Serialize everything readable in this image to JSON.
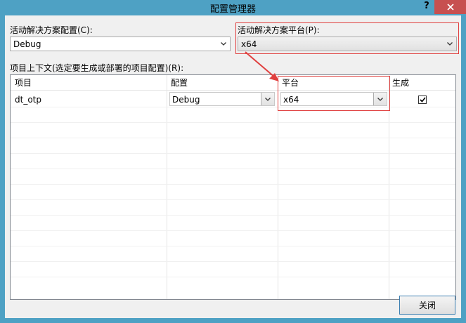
{
  "window": {
    "title": "配置管理器",
    "help_label": "?"
  },
  "active_config": {
    "label": "活动解决方案配置(C):",
    "value": "Debug"
  },
  "active_platform": {
    "label": "活动解决方案平台(P):",
    "value": "x64"
  },
  "project_context": {
    "label": "项目上下文(选定要生成或部署的项目配置)(R):",
    "headers": {
      "project": "项目",
      "config": "配置",
      "platform": "平台",
      "build": "生成"
    },
    "rows": [
      {
        "project": "dt_otp",
        "config": "Debug",
        "platform": "x64",
        "build": true
      }
    ]
  },
  "footer": {
    "close_label": "关闭"
  },
  "colors": {
    "accent": "#4ea1c4",
    "highlight": "#e0403f",
    "close_hover": "#c75050"
  }
}
